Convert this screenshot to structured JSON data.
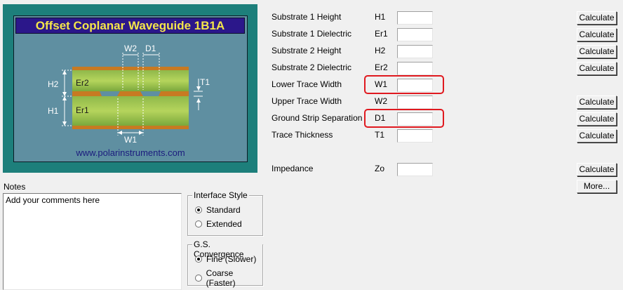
{
  "diagram": {
    "title": "Offset Coplanar Waveguide 1B1A",
    "website": "www.polarinstruments.com",
    "labels": {
      "w2": "W2",
      "d1": "D1",
      "h2": "H2",
      "er2": "Er2",
      "t1": "T1",
      "h1": "H1",
      "er1": "Er1",
      "w1": "W1"
    }
  },
  "parameters": [
    {
      "label": "Substrate 1 Height",
      "symbol": "H1",
      "value": "",
      "button": "Calculate"
    },
    {
      "label": "Substrate 1 Dielectric",
      "symbol": "Er1",
      "value": "",
      "button": "Calculate"
    },
    {
      "label": "Substrate 2 Height",
      "symbol": "H2",
      "value": "",
      "button": "Calculate"
    },
    {
      "label": "Substrate 2 Dielectric",
      "symbol": "Er2",
      "value": "",
      "button": "Calculate"
    },
    {
      "label": "Lower Trace Width",
      "symbol": "W1",
      "value": ""
    },
    {
      "label": "Upper Trace Width",
      "symbol": "W2",
      "value": "",
      "button": "Calculate"
    },
    {
      "label": "Ground Strip Separation",
      "symbol": "D1",
      "value": "",
      "button": "Calculate"
    },
    {
      "label": "Trace Thickness",
      "symbol": "T1",
      "value": "",
      "button": "Calculate"
    }
  ],
  "impedance": {
    "label": "Impedance",
    "symbol": "Zo",
    "value": "",
    "button": "Calculate",
    "more_button": "More..."
  },
  "notes": {
    "label": "Notes",
    "text": "Add your comments here"
  },
  "interface_style": {
    "title": "Interface Style",
    "options": [
      {
        "label": "Standard",
        "selected": true
      },
      {
        "label": "Extended",
        "selected": false
      }
    ]
  },
  "gs_convergence": {
    "title": "G.S. Convergence",
    "options": [
      {
        "label": "Fine (Slower)",
        "selected": true
      },
      {
        "label": "Coarse (Faster)",
        "selected": false
      }
    ]
  },
  "colors": {
    "highlight": "#e0191f",
    "title_bar": "#2b178a",
    "title_text": "#f4e64a",
    "panel_bg": "#5f8fa1",
    "frame_bg": "#1d7f7b"
  }
}
